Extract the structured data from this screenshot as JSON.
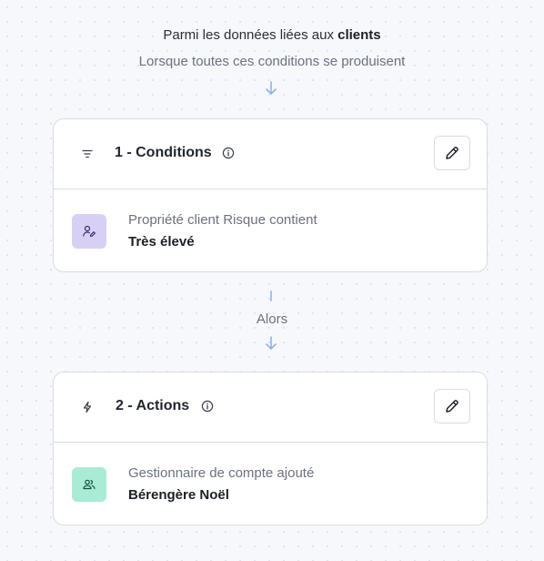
{
  "header": {
    "line1_prefix": "Parmi les données liées aux",
    "line1_entity": "clients",
    "line2": "Lorsque toutes ces conditions se produisent"
  },
  "conditions": {
    "title": "1 - Conditions",
    "icon": "filter-icon",
    "item": {
      "label": "Propriété client Risque contient",
      "value": "Très élevé",
      "icon": "user-edit-icon",
      "color": "#d8cff5"
    }
  },
  "connector": {
    "label": "Alors"
  },
  "actions": {
    "title": "2 - Actions",
    "icon": "lightning-icon",
    "item": {
      "label": "Gestionnaire de compte ajouté",
      "value": "Bérengère Noël",
      "icon": "users-icon",
      "color": "#a8ecd6"
    }
  }
}
